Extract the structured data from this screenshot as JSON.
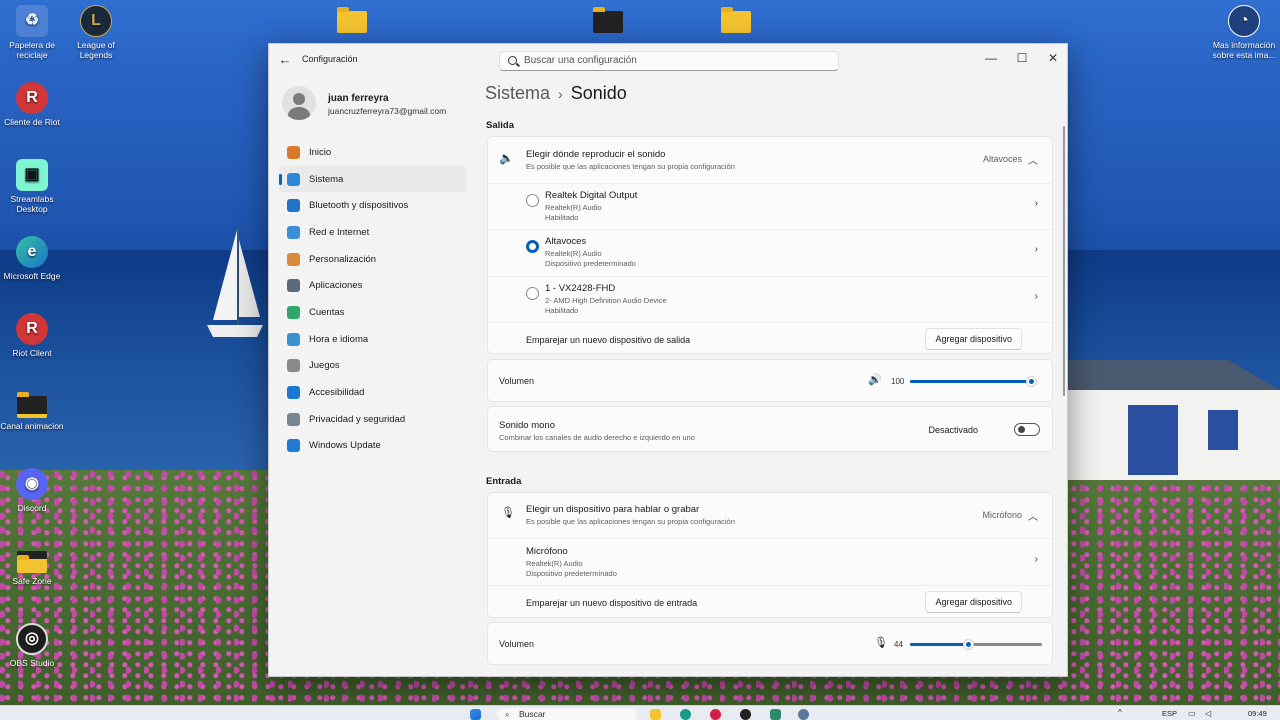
{
  "desktop": {
    "icons": [
      {
        "label": "Papelera de reciclaje"
      },
      {
        "label": "League of Legends"
      },
      {
        "label": "Cliente de Riot"
      },
      {
        "label": "Streamlabs Desktop"
      },
      {
        "label": "Microsoft Edge"
      },
      {
        "label": "Riot Client"
      },
      {
        "label": "Canal animacion"
      },
      {
        "label": "Discord"
      },
      {
        "label": "Safe Zone"
      },
      {
        "label": "OBS Studio"
      },
      {
        "label": "Mas información sobre esta ima..."
      }
    ]
  },
  "window": {
    "app_title": "Configuración",
    "search_placeholder": "Buscar una configuración",
    "controls": {
      "minimize": "—",
      "maximize": "☐",
      "close": "✕"
    }
  },
  "profile": {
    "name": "juan ferreyra",
    "email": "juancruzferreyra73@gmail.com"
  },
  "nav": {
    "items": [
      {
        "label": "Inicio",
        "icon": "home-icon",
        "color": "#d87a2a"
      },
      {
        "label": "Sistema",
        "icon": "monitor-icon",
        "color": "#2b89d8"
      },
      {
        "label": "Bluetooth y dispositivos",
        "icon": "bluetooth-icon",
        "color": "#1f74c8"
      },
      {
        "label": "Red e Internet",
        "icon": "wifi-icon",
        "color": "#3a8fd8"
      },
      {
        "label": "Personalización",
        "icon": "brush-icon",
        "color": "#d88a3a"
      },
      {
        "label": "Aplicaciones",
        "icon": "apps-icon",
        "color": "#5a6a7a"
      },
      {
        "label": "Cuentas",
        "icon": "person-icon",
        "color": "#2fa66b"
      },
      {
        "label": "Hora e idioma",
        "icon": "globe-clock-icon",
        "color": "#3a90d0"
      },
      {
        "label": "Juegos",
        "icon": "gamepad-icon",
        "color": "#8a8a8a"
      },
      {
        "label": "Accesibilidad",
        "icon": "accessibility-icon",
        "color": "#1a7ad0"
      },
      {
        "label": "Privacidad y seguridad",
        "icon": "shield-icon",
        "color": "#7a8490"
      },
      {
        "label": "Windows Update",
        "icon": "update-icon",
        "color": "#1f7ad0"
      }
    ],
    "active_index": 1
  },
  "breadcrumb": {
    "parent": "Sistema",
    "separator": "›",
    "current": "Sonido"
  },
  "output": {
    "section_title": "Salida",
    "choose": {
      "title": "Elegir dónde reproducir el sonido",
      "subtitle": "Es posible que las aplicaciones tengan su propia configuración",
      "value": "Altavoces"
    },
    "devices": [
      {
        "name": "Realtek Digital Output",
        "driver": "Realtek(R) Audio",
        "status": "Habilitado",
        "selected": false
      },
      {
        "name": "Altavoces",
        "driver": "Realtek(R) Audio",
        "status": "Dispositivo predeterminado",
        "selected": true
      },
      {
        "name": "1 - VX2428-FHD",
        "driver": "2- AMD High Definition Audio Device",
        "status": "Habilitado",
        "selected": false
      }
    ],
    "pair_label": "Emparejar un nuevo dispositivo de salida",
    "add_button": "Agregar dispositivo",
    "volume": {
      "label": "Volumen",
      "value": "100",
      "level": 1.0
    },
    "mono": {
      "title": "Sonido mono",
      "subtitle": "Combinar los canales de audio derecho e izquierdo en uno",
      "state": "Desactivado"
    }
  },
  "input": {
    "section_title": "Entrada",
    "choose": {
      "title": "Elegir un dispositivo para hablar o grabar",
      "subtitle": "Es posible que las aplicaciones tengan su propia configuración",
      "value": "Micrófono"
    },
    "device": {
      "name": "Micrófono",
      "driver": "Realtek(R) Audio",
      "status": "Dispositivo predeterminado"
    },
    "pair_label": "Emparejar un nuevo dispositivo de entrada",
    "add_button": "Agregar dispositivo",
    "volume": {
      "label": "Volumen",
      "value": "44",
      "level": 0.44
    }
  },
  "taskbar": {
    "search_label": "Buscar",
    "language": "ESP",
    "time": "09:49"
  },
  "colors": {
    "accent": "#005fb8"
  }
}
